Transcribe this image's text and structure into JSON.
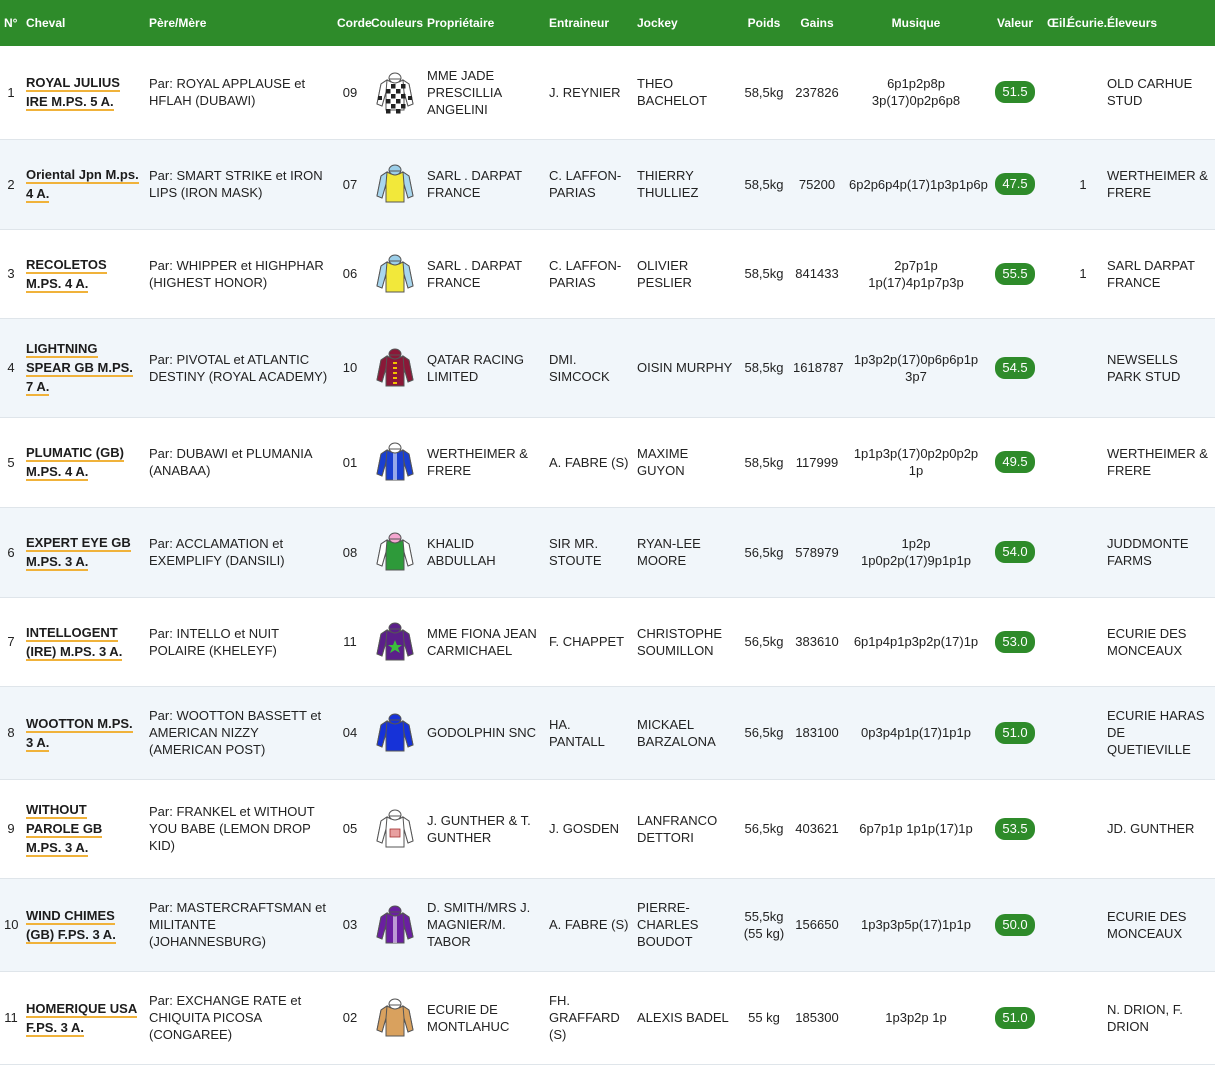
{
  "headers": {
    "num": "N°",
    "horse": "Cheval",
    "parents": "Père/Mère",
    "draw": "Corde",
    "colors": "Couleurs",
    "owner": "Propriétaire",
    "trainer": "Entraineur",
    "jockey": "Jockey",
    "weight": "Poids",
    "earnings": "Gains",
    "music": "Musique",
    "value": "Valeur",
    "eye": "Œil.",
    "stable": "Écurie.",
    "breeders": "Éleveurs"
  },
  "rows": [
    {
      "num": "1",
      "horse": "ROYAL JULIUS IRE M.PS. 5 A.",
      "parents": "Par: ROYAL APPLAUSE et HFLAH (DUBAWI)",
      "draw": "09",
      "silks": "checkered-silks-icon",
      "owner": "MME JADE PRESCILLIA ANGELINI",
      "trainer": "J. REYNIER",
      "jockey": "THEO BACHELOT",
      "weight": "58,5kg",
      "earnings": "237826",
      "music": "6p1p2p8p 3p(17)0p2p6p8",
      "value": "51.5",
      "stable": "",
      "breeder": "OLD CARHUE STUD",
      "body": "#ffffff",
      "cap": "#ffffff",
      "sleeve": "#ffffff",
      "pattern": "check"
    },
    {
      "num": "2",
      "horse": "Oriental Jpn M.ps. 4 A.",
      "parents": "Par: SMART STRIKE et IRON LIPS (IRON MASK)",
      "draw": "07",
      "silks": "yellow-silks-icon",
      "owner": "SARL . DARPAT FRANCE",
      "trainer": "C. LAFFON-PARIAS",
      "jockey": "THIERRY THULLIEZ",
      "weight": "58,5kg",
      "earnings": "75200",
      "music": "6p2p6p4p(17)1p3p1p6p",
      "value": "47.5",
      "stable": "1",
      "breeder": "WERTHEIMER & FRERE",
      "body": "#f2e83a",
      "cap": "#9ccfe9",
      "sleeve": "#a8d6ee",
      "pattern": "plain"
    },
    {
      "num": "3",
      "horse": "RECOLETOS M.PS. 4 A.",
      "parents": "Par: WHIPPER et HIGHPHAR (HIGHEST HONOR)",
      "draw": "06",
      "silks": "yellow-silks-icon",
      "owner": "SARL . DARPAT FRANCE",
      "trainer": "C. LAFFON-PARIAS",
      "jockey": "OLIVIER PESLIER",
      "weight": "58,5kg",
      "earnings": "841433",
      "music": "2p7p1p 1p(17)4p1p7p3p",
      "value": "55.5",
      "stable": "1",
      "breeder": "SARL DARPAT FRANCE",
      "body": "#f2e83a",
      "cap": "#9ccfe9",
      "sleeve": "#a8d6ee",
      "pattern": "plain"
    },
    {
      "num": "4",
      "horse": "LIGHTNING SPEAR GB M.PS. 7 A.",
      "parents": "Par: PIVOTAL et ATLANTIC DESTINY (ROYAL ACADEMY)",
      "draw": "10",
      "silks": "maroon-silks-icon",
      "owner": "QATAR RACING LIMITED",
      "trainer": "DMI. SIMCOCK",
      "jockey": "OISIN MURPHY",
      "weight": "58,5kg",
      "earnings": "1618787",
      "music": "1p3p2p(17)0p6p6p1p 3p7",
      "value": "54.5",
      "stable": "",
      "breeder": "NEWSELLS PARK STUD",
      "body": "#8a1838",
      "cap": "#8a1838",
      "sleeve": "#8a1838",
      "pattern": "braid"
    },
    {
      "num": "5",
      "horse": "PLUMATIC (GB) M.PS. 4 A.",
      "parents": "Par: DUBAWI et PLUMANIA (ANABAA)",
      "draw": "01",
      "silks": "blue-white-silks-icon",
      "owner": "WERTHEIMER & FRERE",
      "trainer": "A. FABRE (S)",
      "jockey": "MAXIME GUYON",
      "weight": "58,5kg",
      "earnings": "117999",
      "music": "1p1p3p(17)0p2p0p2p 1p",
      "value": "49.5",
      "stable": "",
      "breeder": "WERTHEIMER & FRERE",
      "body": "#1a3fd0",
      "cap": "#ffffff",
      "sleeve": "#1a3fd0",
      "pattern": "stripe"
    },
    {
      "num": "6",
      "horse": "EXPERT EYE GB M.PS. 3 A.",
      "parents": "Par: ACCLAMATION et EXEMPLIFY (DANSILI)",
      "draw": "08",
      "silks": "green-pink-silks-icon",
      "owner": "KHALID ABDULLAH",
      "trainer": "SIR MR. STOUTE",
      "jockey": "RYAN-LEE MOORE",
      "weight": "56,5kg",
      "earnings": "578979",
      "music": "1p2p 1p0p2p(17)9p1p1p",
      "value": "54.0",
      "stable": "",
      "breeder": "JUDDMONTE FARMS",
      "body": "#2e9a3a",
      "cap": "#f4a6d0",
      "sleeve": "#ffffff",
      "pattern": "plain"
    },
    {
      "num": "7",
      "horse": "INTELLOGENT (IRE) M.PS. 3 A.",
      "parents": "Par: INTELLO et NUIT POLAIRE (KHELEYF)",
      "draw": "11",
      "silks": "purple-star-silks-icon",
      "owner": "MME FIONA JEAN CARMICHAEL",
      "trainer": "F. CHAPPET",
      "jockey": "CHRISTOPHE SOUMILLON",
      "weight": "56,5kg",
      "earnings": "383610",
      "music": "6p1p4p1p3p2p(17)1p",
      "value": "53.0",
      "stable": "",
      "breeder": "ECURIE DES MONCEAUX",
      "body": "#5b1f8a",
      "cap": "#5b1f8a",
      "sleeve": "#5b1f8a",
      "pattern": "star"
    },
    {
      "num": "8",
      "horse": "WOOTTON M.PS. 3 A.",
      "parents": "Par: WOOTTON BASSETT et AMERICAN NIZZY (AMERICAN POST)",
      "draw": "04",
      "silks": "royal-blue-silks-icon",
      "owner": "GODOLPHIN SNC",
      "trainer": "HA. PANTALL",
      "jockey": "MICKAEL BARZALONA",
      "weight": "56,5kg",
      "earnings": "183100",
      "music": "0p3p4p1p(17)1p1p",
      "value": "51.0",
      "stable": "",
      "breeder": "ECURIE HARAS DE QUETIEVILLE",
      "body": "#1632d8",
      "cap": "#1632d8",
      "sleeve": "#1632d8",
      "pattern": "plain"
    },
    {
      "num": "9",
      "horse": "WITHOUT PAROLE GB M.PS. 3 A.",
      "parents": "Par: FRANKEL et WITHOUT YOU BABE (LEMON DROP KID)",
      "draw": "05",
      "silks": "white-silks-icon",
      "owner": "J. GUNTHER & T. GUNTHER",
      "trainer": "J. GOSDEN",
      "jockey": "LANFRANCO DETTORI",
      "weight": "56,5kg",
      "earnings": "403621",
      "music": "6p7p1p 1p1p(17)1p",
      "value": "53.5",
      "stable": "",
      "breeder": "JD. GUNTHER",
      "body": "#ffffff",
      "cap": "#ffffff",
      "sleeve": "#ffffff",
      "pattern": "badge"
    },
    {
      "num": "10",
      "horse": "WIND CHIMES (GB) F.PS. 3 A.",
      "parents": "Par: MASTERCRAFTSMAN et MILITANTE (JOHANNESBURG)",
      "draw": "03",
      "silks": "purple-stripe-silks-icon",
      "owner": "D. SMITH/MRS J. MAGNIER/M. TABOR",
      "trainer": "A. FABRE (S)",
      "jockey": "PIERRE-CHARLES BOUDOT",
      "weight": "55,5kg (55 kg)",
      "earnings": "156650",
      "music": "1p3p3p5p(17)1p1p",
      "value": "50.0",
      "stable": "",
      "breeder": "ECURIE DES MONCEAUX",
      "body": "#6a1fa0",
      "cap": "#6a1fa0",
      "sleeve": "#6a1fa0",
      "pattern": "stripe"
    },
    {
      "num": "11",
      "horse": "HOMERIQUE USA F.PS. 3 A.",
      "parents": "Par: EXCHANGE RATE et CHIQUITA PICOSA (CONGAREE)",
      "draw": "02",
      "silks": "tan-silks-icon",
      "owner": "ECURIE DE MONTLAHUC",
      "trainer": "FH. GRAFFARD (S)",
      "jockey": "ALEXIS BADEL",
      "weight": "55 kg",
      "earnings": "185300",
      "music": "1p3p2p 1p",
      "value": "51.0",
      "stable": "",
      "breeder": "N. DRION, F. DRION",
      "body": "#d9a15e",
      "cap": "#ffffff",
      "sleeve": "#d9a15e",
      "pattern": "plain"
    }
  ]
}
